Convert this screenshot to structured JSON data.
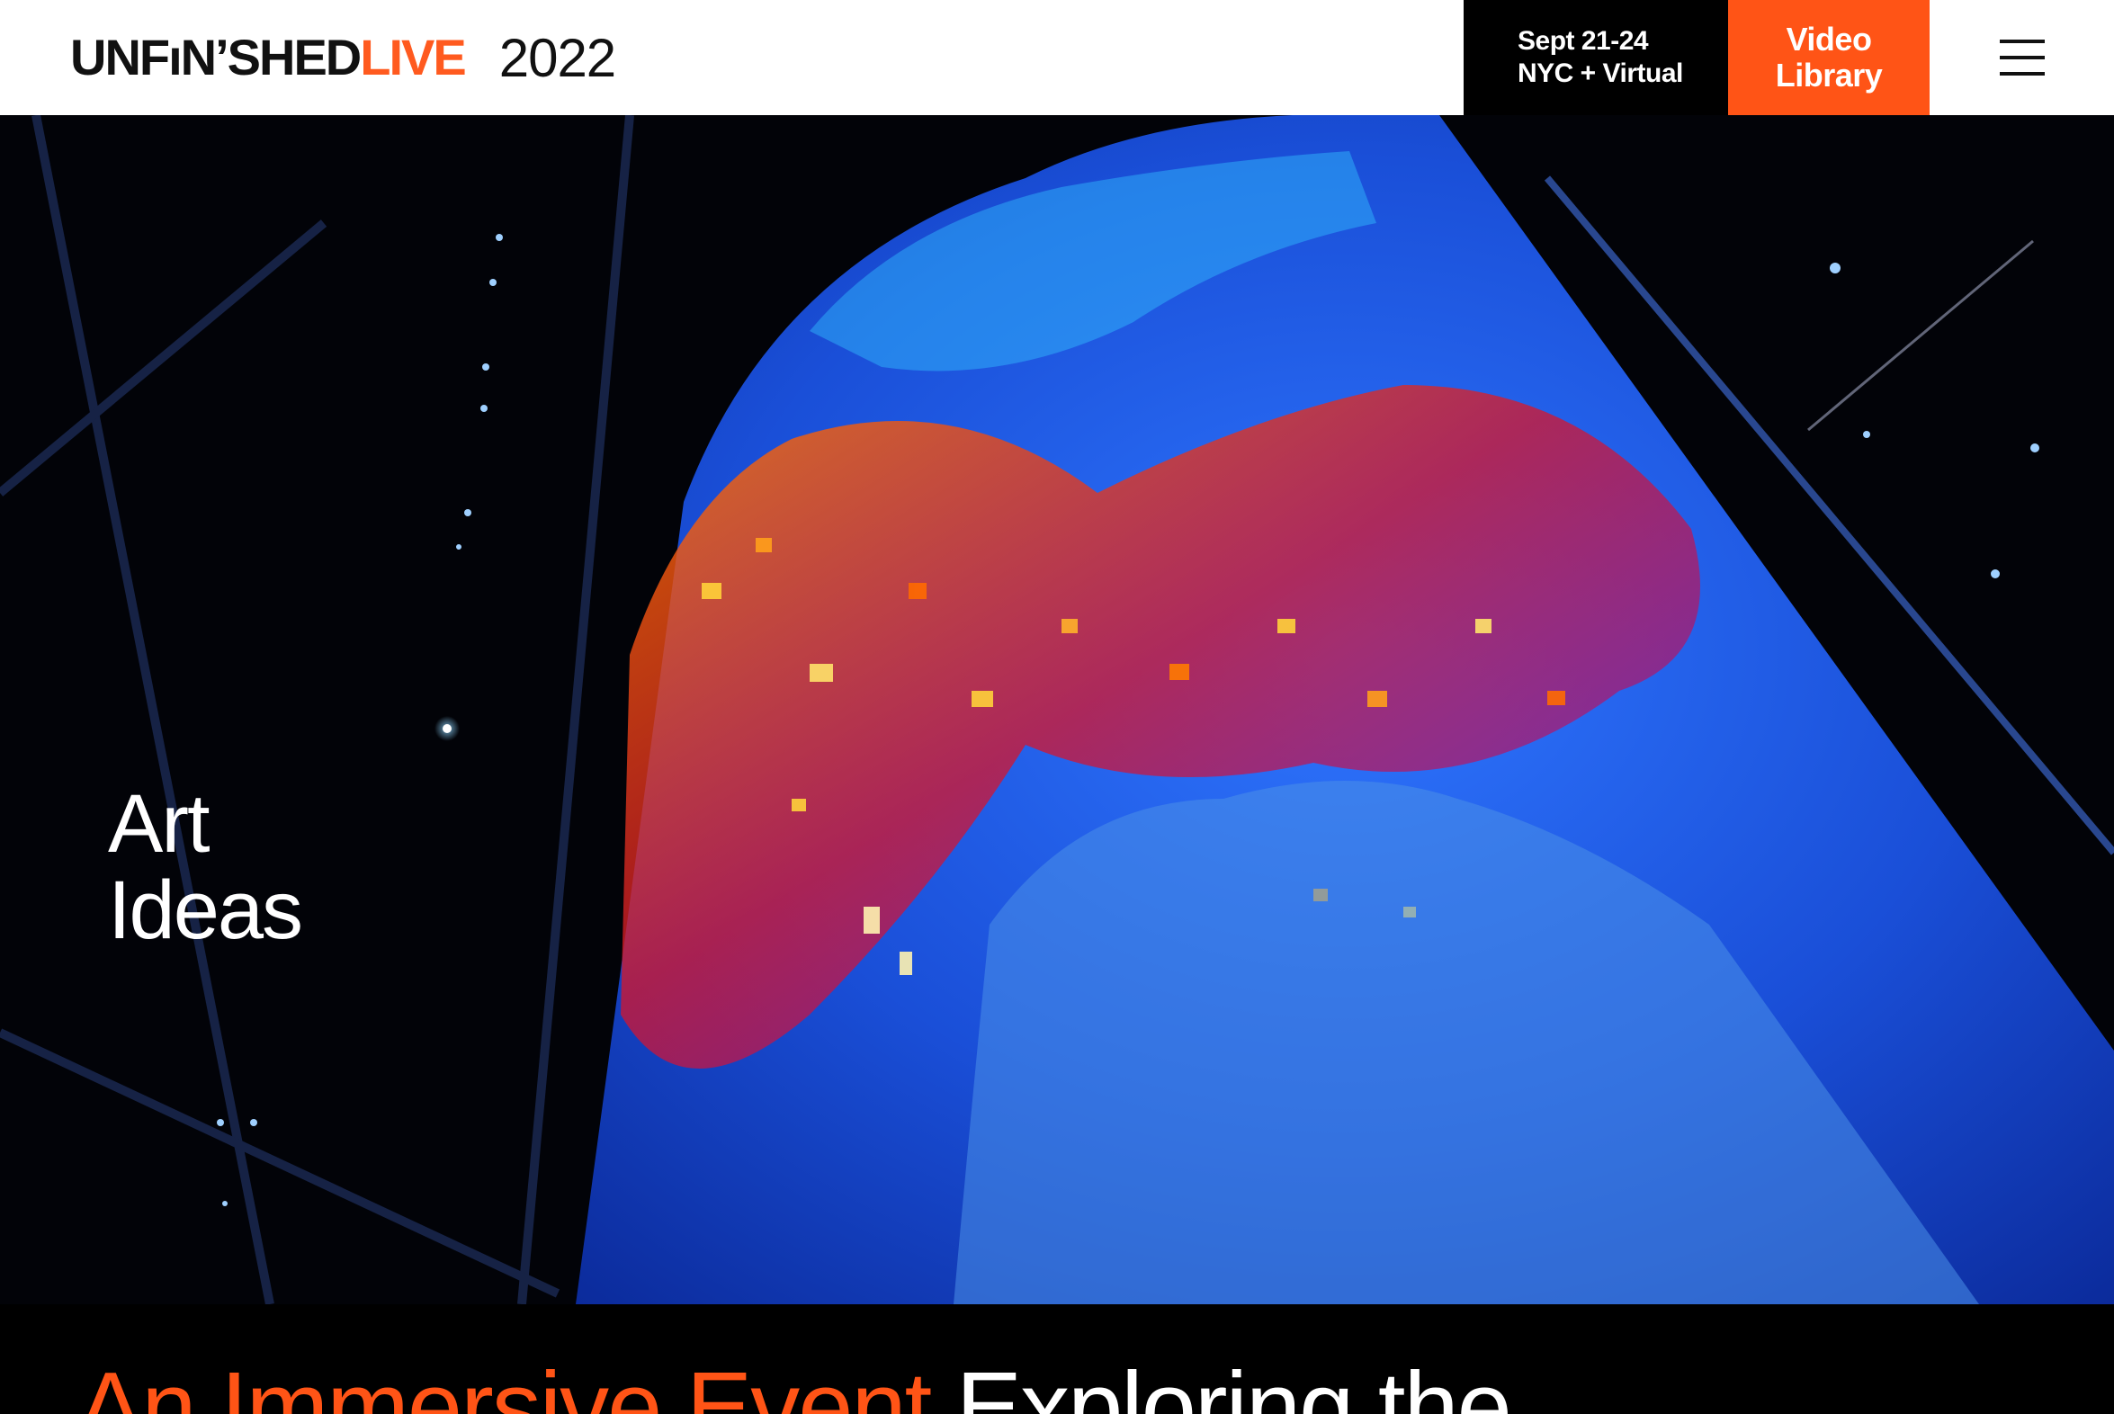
{
  "header": {
    "logo_part1": "UNFıNʼSHED",
    "logo_part2": "LIVE",
    "logo_year": "2022",
    "dates_line1": "Sept 21-24",
    "dates_line2": "NYC + Virtual",
    "video_line1": "Video",
    "video_line2": "Library",
    "menu_icon": "hamburger-menu-icon"
  },
  "hero": {
    "caption_line1": "Art",
    "caption_line2": "Ideas",
    "image": "immersive-projection-cone"
  },
  "headline": {
    "accent_text": "An Immersive Event ",
    "rest_text": "Exploring the"
  },
  "colors": {
    "accent": "#ff5416",
    "header_bg": "#ffffff",
    "dark": "#000000",
    "projection_blue": "#1f5fe0"
  }
}
